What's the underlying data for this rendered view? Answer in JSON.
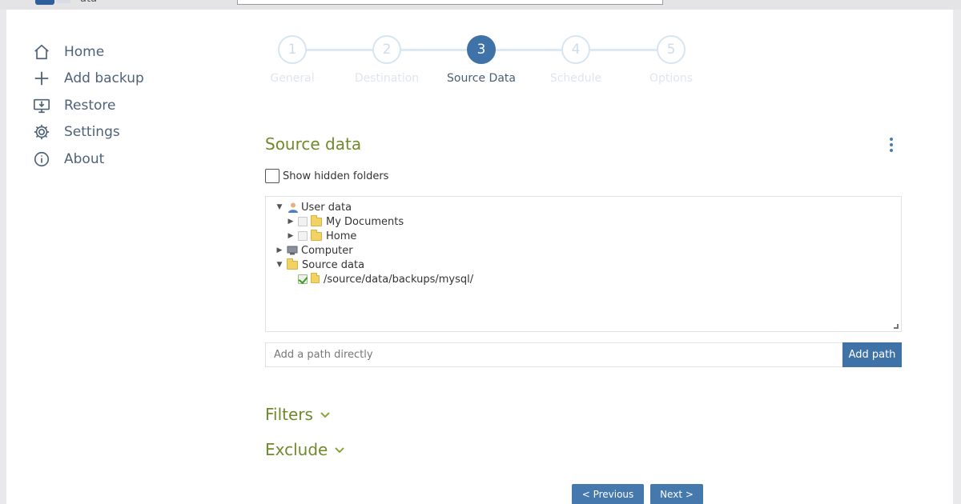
{
  "app": {
    "logo_text": "ata"
  },
  "sidebar": {
    "items": [
      {
        "label": "Home",
        "icon": "home-icon"
      },
      {
        "label": "Add backup",
        "icon": "plus-icon"
      },
      {
        "label": "Restore",
        "icon": "restore-icon"
      },
      {
        "label": "Settings",
        "icon": "gear-icon"
      },
      {
        "label": "About",
        "icon": "info-icon"
      }
    ]
  },
  "stepper": {
    "active": 3,
    "steps": [
      {
        "number": "1",
        "label": "General"
      },
      {
        "number": "2",
        "label": "Destination"
      },
      {
        "number": "3",
        "label": "Source Data"
      },
      {
        "number": "4",
        "label": "Schedule"
      },
      {
        "number": "5",
        "label": "Options"
      }
    ]
  },
  "source": {
    "title": "Source data",
    "show_hidden_label": "Show hidden folders",
    "tree": {
      "user_data": "User data",
      "my_documents": "My Documents",
      "home": "Home",
      "computer": "Computer",
      "source_data": "Source data",
      "selected_path": "/source/data/backups/mysql/"
    },
    "path_placeholder": "Add a path directly",
    "add_path_label": "Add path"
  },
  "filters_label": "Filters",
  "exclude_label": "Exclude",
  "nav_buttons": {
    "previous": "< Previous",
    "next": "Next >"
  },
  "colors": {
    "accent": "#3f73a8",
    "section_title": "#6f8a2b",
    "nav_text": "#4f6278"
  }
}
